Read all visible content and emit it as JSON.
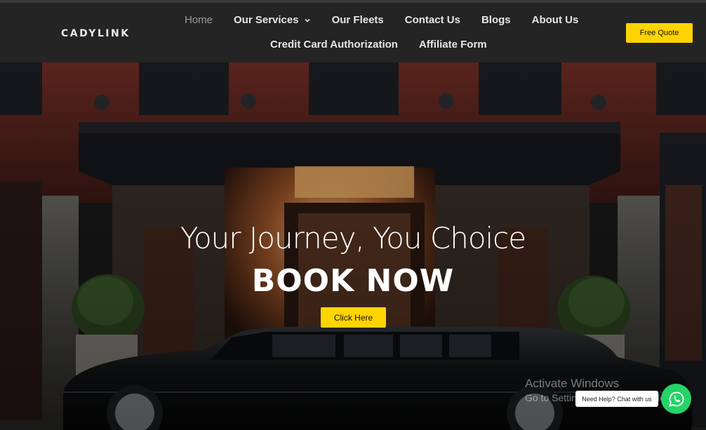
{
  "brand": {
    "logo": "CADYLINK"
  },
  "nav": {
    "row1": [
      "Home",
      "Our Services",
      "Our Fleets",
      "Contact Us",
      "Blogs",
      "About Us"
    ],
    "row2": [
      "Credit Card Authorization",
      "Affiliate Form"
    ]
  },
  "header": {
    "quote_label": "Free Quote"
  },
  "hero": {
    "title": "Your Journey, You Choice",
    "subtitle": "BOOK NOW",
    "cta_label": "Click Here"
  },
  "overlay": {
    "watermark_line1": "Activate Windows",
    "watermark_line2": "Go to Settings to activate Windows.",
    "chat_text": "Need Help? Chat with us"
  },
  "colors": {
    "accent": "#ffd400",
    "header_bg": "#242424",
    "whatsapp": "#25d366"
  },
  "icons": {
    "dropdown": "chevron-down-icon",
    "chat": "whatsapp-icon"
  }
}
